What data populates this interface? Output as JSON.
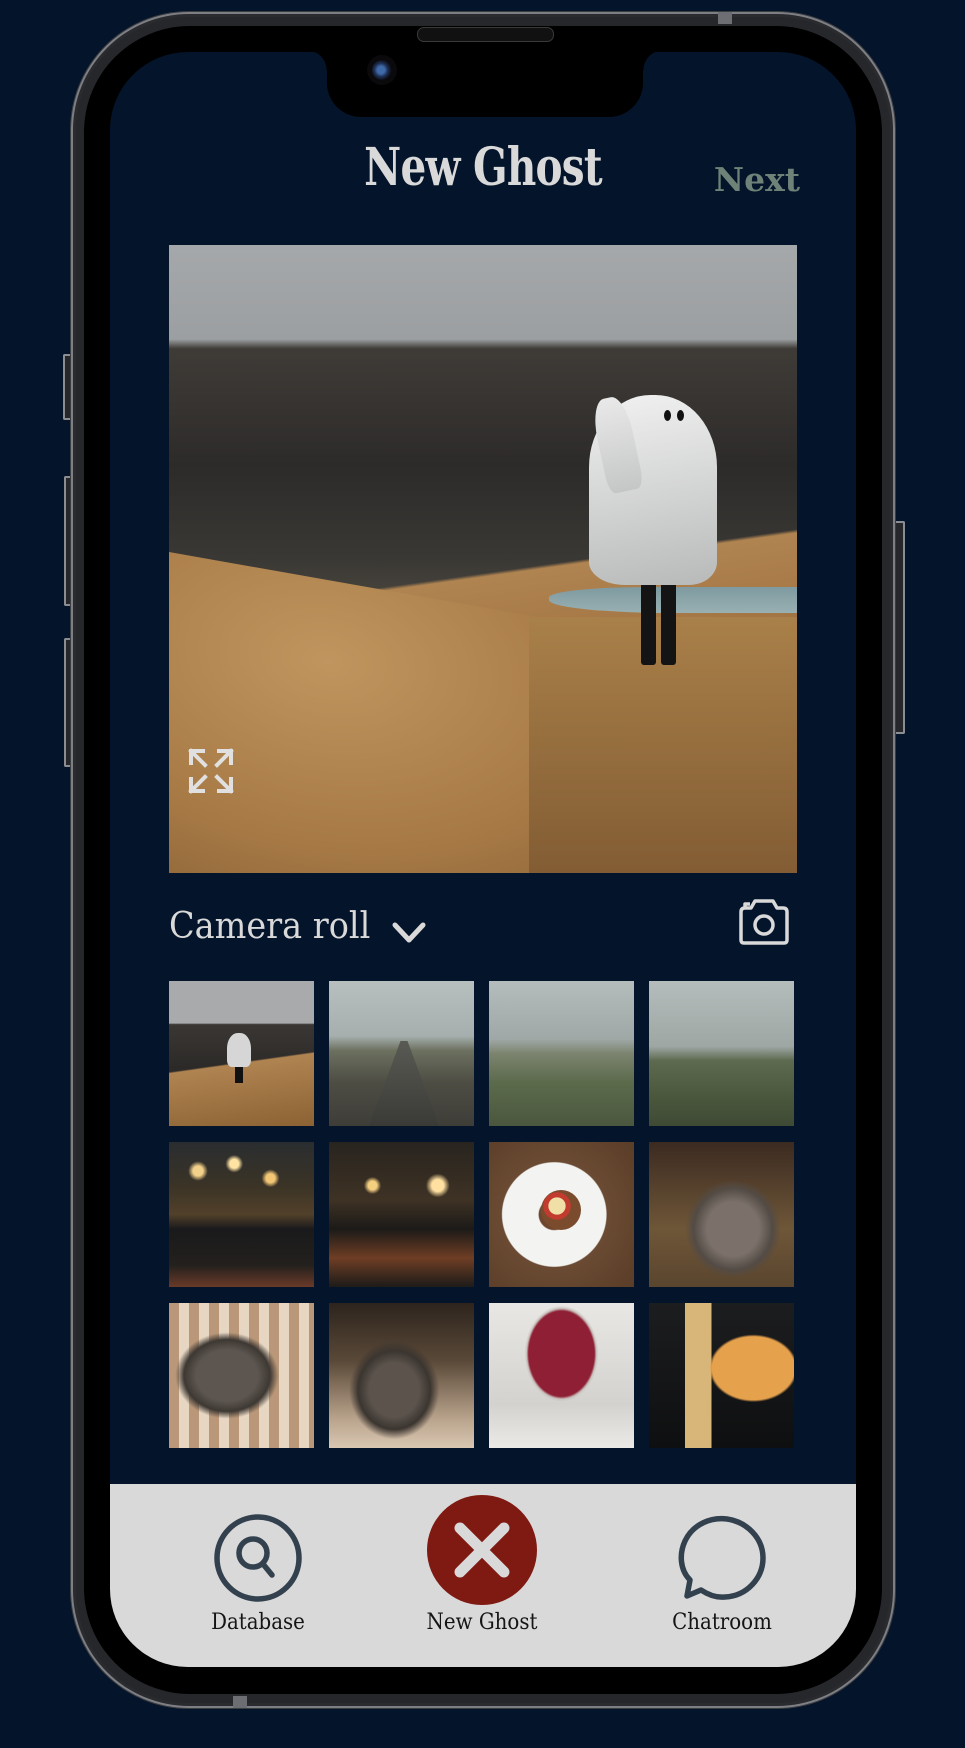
{
  "header": {
    "title": "New Ghost",
    "next_label": "Next"
  },
  "preview": {
    "description": "Person in a white sheet ghost costume standing on a grassy hillside",
    "expand_icon": "expand-arrows-icon"
  },
  "camera_roll": {
    "title": "Camera roll",
    "dropdown_icon": "chevron-down-icon",
    "camera_icon": "camera-icon",
    "thumbnails": [
      {
        "label": "Ghost on hillside"
      },
      {
        "label": "Foggy road"
      },
      {
        "label": "Foggy field with swans"
      },
      {
        "label": "Foggy grass with fence"
      },
      {
        "label": "Pub interior"
      },
      {
        "label": "Bar with chandeliers"
      },
      {
        "label": "Pancakes with fruit"
      },
      {
        "label": "Fluffy rabbit"
      },
      {
        "label": "Rabbit on blanket"
      },
      {
        "label": "Rabbit on chair"
      },
      {
        "label": "Red cocktail"
      },
      {
        "label": "Beer and can"
      }
    ]
  },
  "bottom_nav": {
    "items": [
      {
        "label": "Database",
        "icon": "search-icon"
      },
      {
        "label": "New Ghost",
        "icon": "close-icon",
        "active": true
      },
      {
        "label": "Chatroom",
        "icon": "chat-bubble-icon"
      }
    ]
  },
  "colors": {
    "background": "#04142a",
    "title_text": "#d9d9d9",
    "next_accent": "#6e8278",
    "nav_background": "#d9d9d9",
    "nav_icon": "#33414f",
    "active_button": "#7f1a12"
  }
}
